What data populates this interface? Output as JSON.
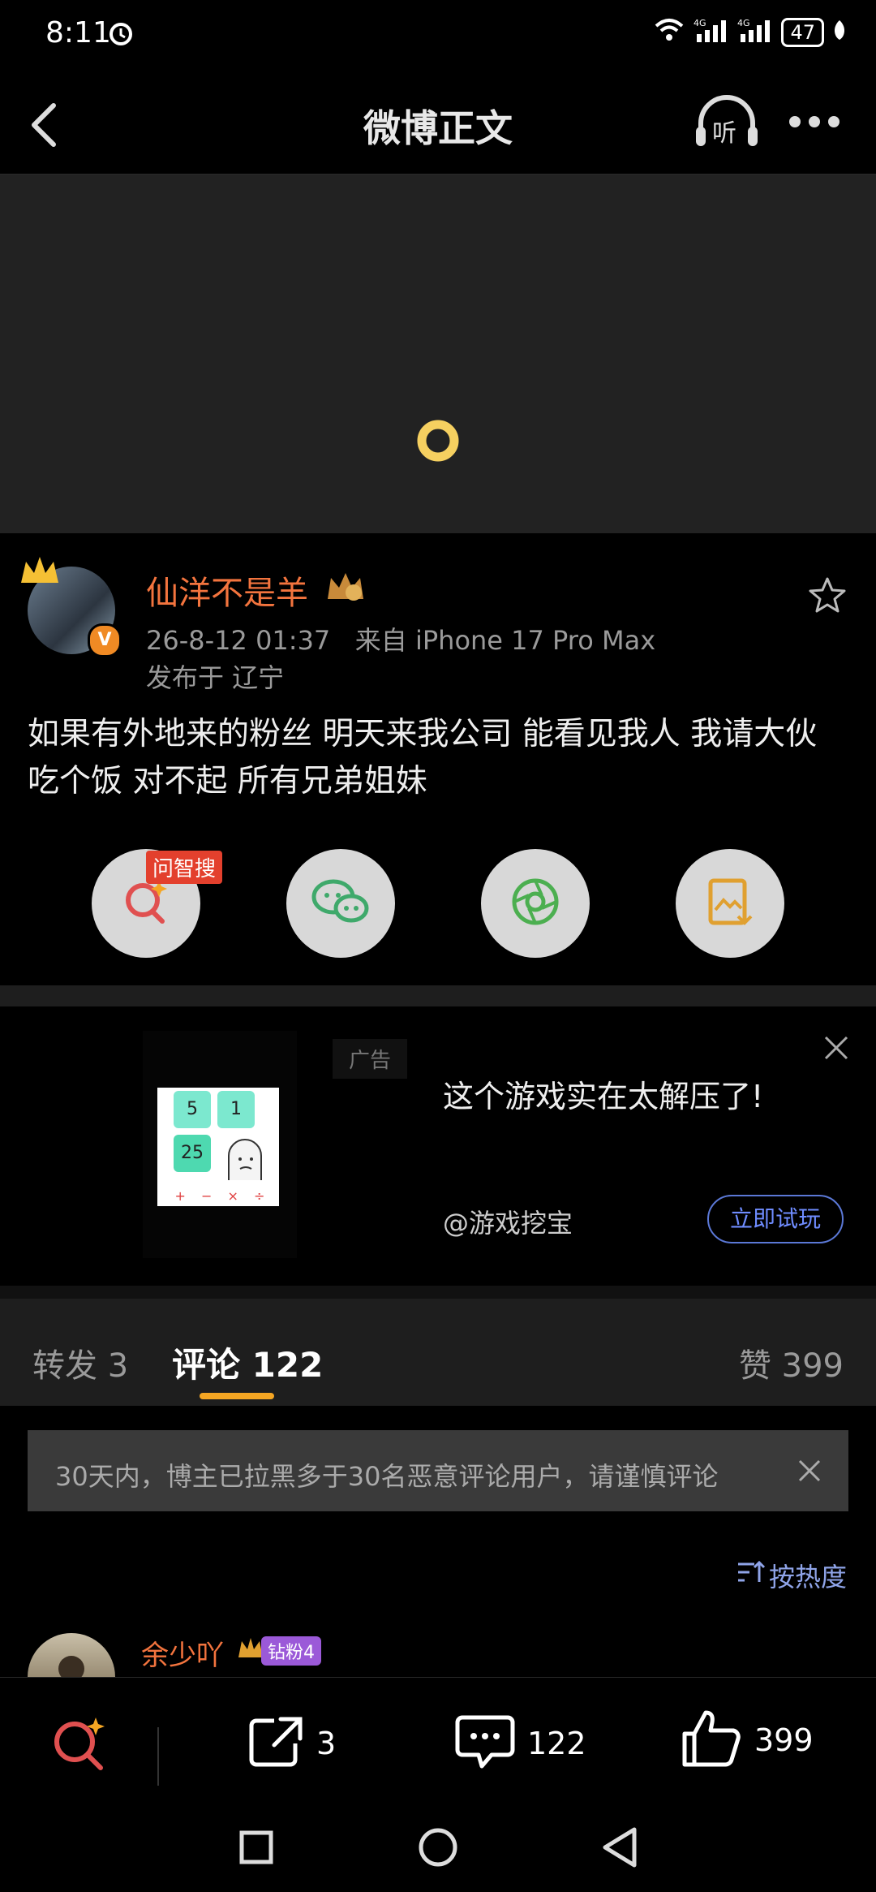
{
  "status_bar": {
    "time": "8:11",
    "network": "4G",
    "battery": "47"
  },
  "nav": {
    "title": "微博正文"
  },
  "post": {
    "username": "仙洋不是羊",
    "time": "26-8-12 01:37",
    "source": "来自 iPhone 17 Pro Max",
    "location": "发布于 辽宁",
    "content": "如果有外地来的粉丝 明天来我公司 能看见我人 我请大伙吃个饭 对不起 所有兄弟姐妹",
    "ai_tag": "问智搜"
  },
  "ad": {
    "label": "广告",
    "title": "这个游戏实在太解压了!",
    "source": "@游戏挖宝",
    "cta": "立即试玩",
    "tiles": [
      "5",
      "1",
      "25"
    ],
    "ops": [
      "+",
      "−",
      "×",
      "÷"
    ]
  },
  "tabs": {
    "repost": "转发 3",
    "comment": "评论 122",
    "like": "赞 399"
  },
  "notice": {
    "text": "30天内，博主已拉黑多于30名恶意评论用户，请谨慎评论"
  },
  "sort": {
    "label": "按热度"
  },
  "comment_preview": {
    "username": "余少吖",
    "fan_badge": "钻粉4"
  },
  "bottom_bar": {
    "repost_count": "3",
    "comment_count": "122",
    "like_count": "399"
  },
  "colors": {
    "accent_orange": "#f3743e",
    "tab_underline": "#f5a623",
    "link_blue": "#6f8cff"
  }
}
